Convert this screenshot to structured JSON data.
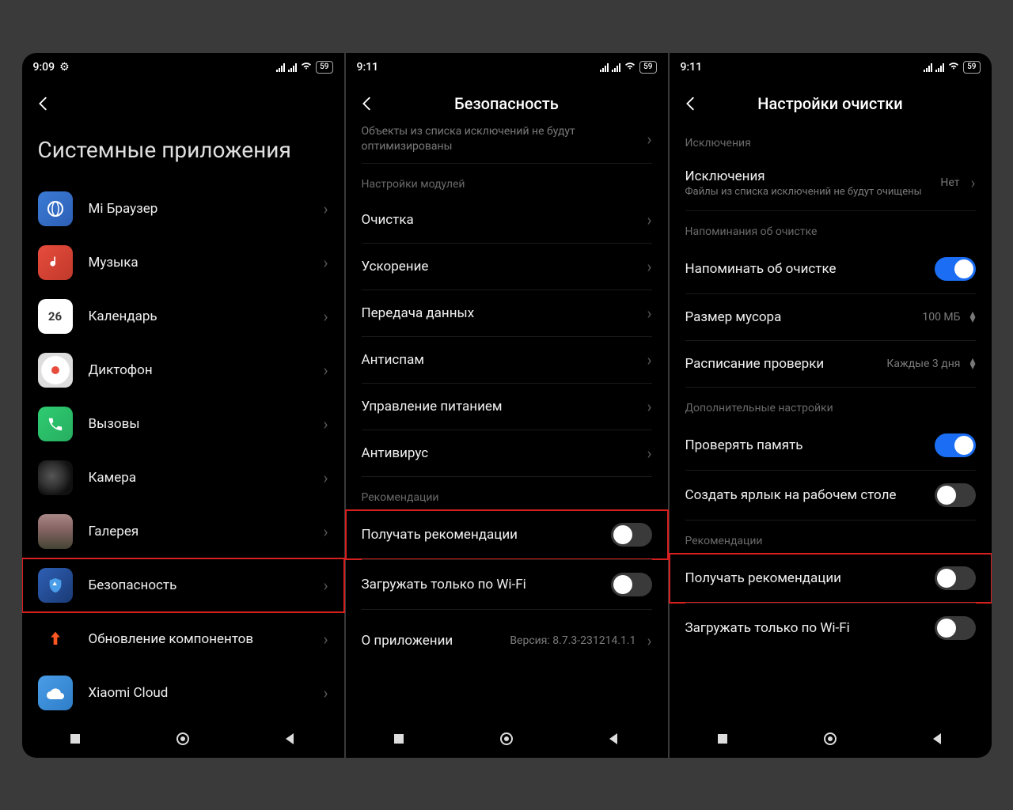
{
  "status": {
    "time1": "9:09",
    "time2": "9:11",
    "time3": "9:11",
    "battery": "59"
  },
  "screen1": {
    "title": "Системные приложения",
    "apps": [
      "Mi Браузер",
      "Музыка",
      "Календарь",
      "Диктофон",
      "Вызовы",
      "Камера",
      "Галерея",
      "Безопасность",
      "Обновление компонентов",
      "Xiaomi Cloud"
    ],
    "calendar_day": "26"
  },
  "screen2": {
    "title": "Безопасность",
    "exclusion_info": "Объекты из списка исключений не будут оптимизированы",
    "section_modules": "Настройки модулей",
    "modules": [
      "Очистка",
      "Ускорение",
      "Передача данных",
      "Антиспам",
      "Управление питанием",
      "Антивирус"
    ],
    "section_recs": "Рекомендации",
    "rec_toggle": "Получать рекомендации",
    "wifi_toggle": "Загружать только по Wi-Fi",
    "about": "О приложении",
    "version": "Версия: 8.7.3-231214.1.1"
  },
  "screen3": {
    "title": "Настройки очистки",
    "sec_excl": "Исключения",
    "excl_label": "Исключения",
    "excl_sub": "Файлы из списка исключений не будут очищены",
    "excl_val": "Нет",
    "sec_remind": "Напоминания об очистке",
    "remind_label": "Напоминать об очистке",
    "size_label": "Размер мусора",
    "size_val": "100 МБ",
    "sched_label": "Расписание проверки",
    "sched_val": "Каждые 3 дня",
    "sec_extra": "Дополнительные настройки",
    "check_mem": "Проверять память",
    "shortcut": "Создать ярлык на рабочем столе",
    "sec_recs": "Рекомендации",
    "rec_toggle": "Получать рекомендации",
    "wifi_toggle": "Загружать только по Wi-Fi"
  }
}
